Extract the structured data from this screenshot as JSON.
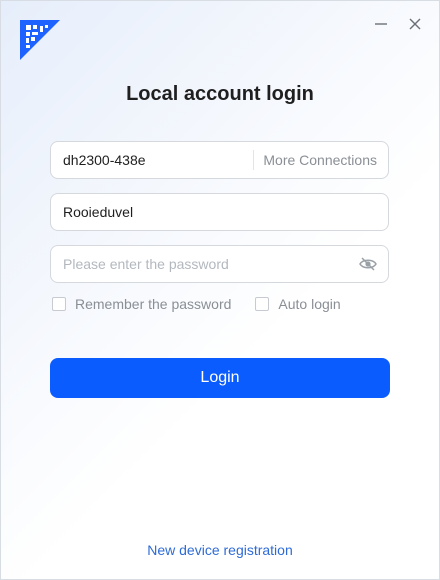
{
  "title": "Local account login",
  "host_field": {
    "value": "dh2300-438e",
    "more_connections_label": "More Connections"
  },
  "username_field": {
    "value": "Rooieduvel"
  },
  "password_field": {
    "placeholder": "Please enter the password",
    "visibility_icon": "eye-slash-icon"
  },
  "options": {
    "remember_password_label": "Remember the password",
    "remember_password_checked": false,
    "auto_login_label": "Auto login",
    "auto_login_checked": false
  },
  "login_button_label": "Login",
  "register_link_label": "New device registration",
  "window_controls": [
    "minimize-icon",
    "close-icon"
  ],
  "colors": {
    "accent": "#0b5cff",
    "link": "#2e6bd6",
    "logo": "#1e63ff"
  }
}
